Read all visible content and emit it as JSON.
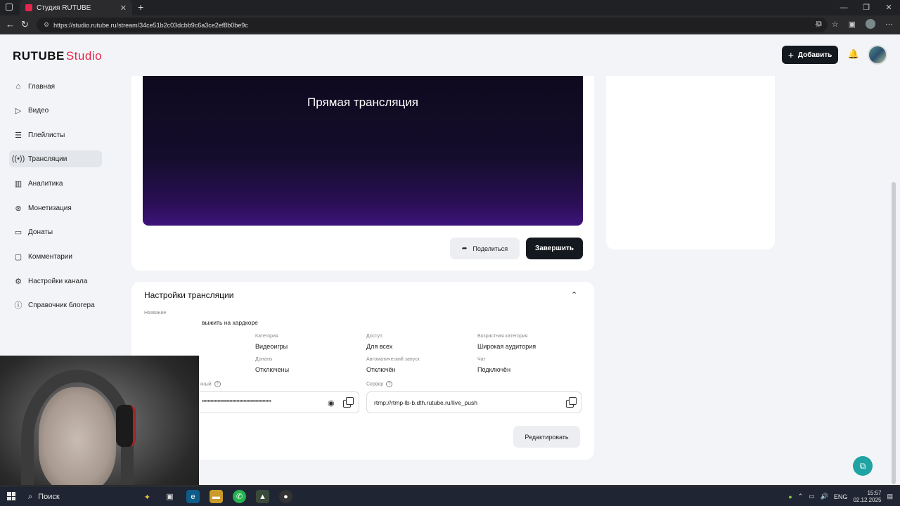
{
  "browser": {
    "tab_title": "Студия RUTUBE",
    "url": "https://studio.rutube.ru/stream/34ce51b2c03dcbb9c6a3ce2ef8b0be9c"
  },
  "header": {
    "logo_main": "RUTUBE",
    "logo_studio": "Studio",
    "add_button": "Добавить"
  },
  "sidebar": {
    "items": [
      {
        "label": "Главная",
        "icon": "home-icon"
      },
      {
        "label": "Видео",
        "icon": "video-icon"
      },
      {
        "label": "Плейлисты",
        "icon": "playlist-icon"
      },
      {
        "label": "Трансляции",
        "icon": "broadcast-icon",
        "active": true
      },
      {
        "label": "Аналитика",
        "icon": "analytics-icon"
      },
      {
        "label": "Монетизация",
        "icon": "money-icon"
      },
      {
        "label": "Донаты",
        "icon": "donate-icon"
      },
      {
        "label": "Комментарии",
        "icon": "comments-icon"
      },
      {
        "label": "Настройки канала",
        "icon": "settings-icon"
      },
      {
        "label": "Справочник блогера",
        "icon": "info-icon"
      }
    ]
  },
  "player": {
    "title": "Прямая трансляция",
    "share_button": "Поделиться",
    "finish_button": "Завершить"
  },
  "settings": {
    "title": "Настройки трансляции",
    "name_label": "Название",
    "name_value_visible": "выжить на хардкоре",
    "category_label": "Категория",
    "category_value": "Видеоигры",
    "access_label": "Доступ",
    "access_value": "Для всех",
    "age_label": "Возрастная категория",
    "age_value": "Широкая аудитория",
    "donates_label": "Донаты",
    "donates_value": "Отключены",
    "autostart_label": "Автоматический запуск",
    "autostart_value": "Отключён",
    "chat_label": "Чат",
    "chat_value": "Подключён",
    "key_label_visible": "нный",
    "key_masked": "••••••••••••••••••••••••••••••••••••••••••••••••",
    "server_label": "Сервер",
    "server_value": "rtmp://rtmp-lb-b.dth.rutube.ru/live_push",
    "edit_button": "Редактировать"
  },
  "taskbar": {
    "search": "Поиск",
    "lang": "ENG",
    "time": "15:57",
    "date": "02.12.2025"
  }
}
